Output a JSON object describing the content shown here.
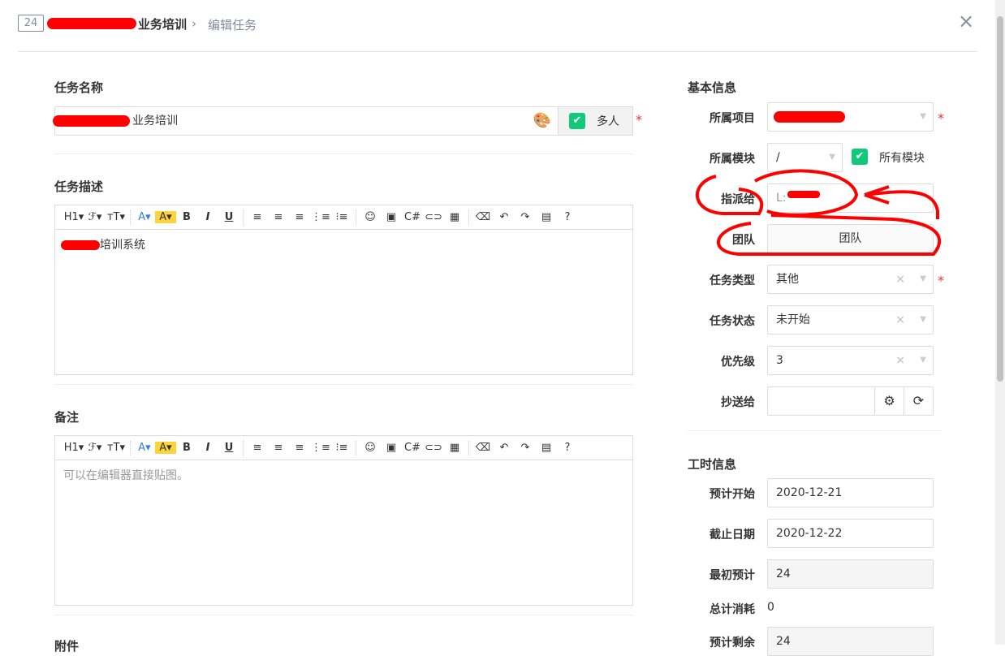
{
  "header": {
    "task_id": "24",
    "title": "业务培训",
    "breadcrumb_sep": "›",
    "breadcrumb_current": "编辑任务",
    "close": "×"
  },
  "main": {
    "name_label": "任务名称",
    "name_value": "业务培训",
    "multi_label": "多人",
    "desc_label": "任务描述",
    "desc_value": "培训系统",
    "notes_label": "备注",
    "notes_placeholder": "可以在编辑器直接贴图。",
    "attach_label": "附件",
    "toolbar": [
      "H1▾",
      "ℱ▾",
      "тT▾",
      "|",
      "A▾",
      "A▾",
      "B",
      "I",
      "U",
      "|",
      "≡",
      "≡",
      "≡",
      "⋮≡",
      "⁝≡",
      "|",
      "☺",
      "▣",
      "C#",
      "⊂⊃",
      "▦",
      "|",
      "⌫",
      "↶",
      "↷",
      "▤",
      "?"
    ]
  },
  "basic": {
    "title": "基本信息",
    "project_label": "所属项目",
    "project_value": "",
    "module_label": "所属模块",
    "module_value": "/",
    "all_modules": "所有模块",
    "assign_label": "指派给",
    "assign_value": "L:",
    "team_label": "团队",
    "team_button": "团队",
    "type_label": "任务类型",
    "type_value": "其他",
    "status_label": "任务状态",
    "status_value": "未开始",
    "priority_label": "优先级",
    "priority_value": "3",
    "cc_label": "抄送给",
    "cc_value": ""
  },
  "effort": {
    "title": "工时信息",
    "start_label": "预计开始",
    "start_value": "2020-12-21",
    "deadline_label": "截止日期",
    "deadline_value": "2020-12-22",
    "estimate_label": "最初预计",
    "estimate_value": "24",
    "consumed_label": "总计消耗",
    "consumed_value": "0",
    "left_label": "预计剩余",
    "left_value": "24"
  },
  "colors": {
    "accent_green": "#10c97a",
    "required": "#ee3333",
    "annotation": "#ff0000"
  }
}
